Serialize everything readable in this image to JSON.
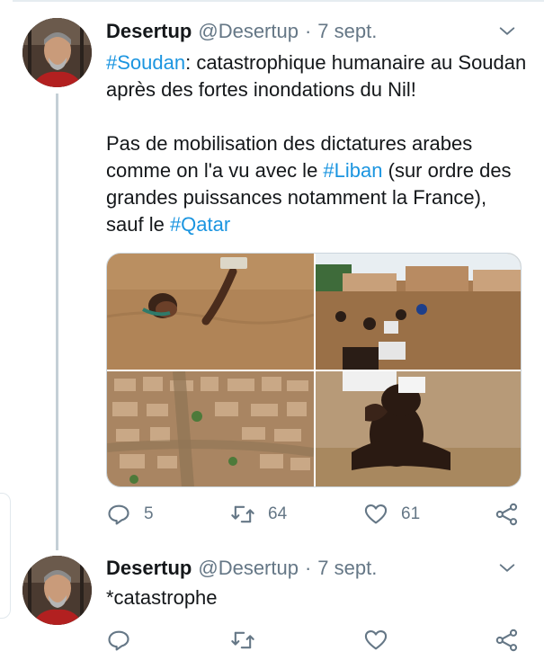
{
  "tweets": [
    {
      "author": {
        "name": "Desertup",
        "handle": "@Desertup"
      },
      "separator": "·",
      "date": "7 sept.",
      "paragraph1": {
        "hashtag1": "#Soudan",
        "text1": ": catastrophique humanaire au Soudan après des fortes inondations du Nil!"
      },
      "paragraph2": {
        "text1": "Pas de mobilisation des dictatures arabes comme on l'a vu avec le ",
        "hashtag1": "#Liban",
        "text2": " (sur ordre des grandes puissances notamment la France), sauf le ",
        "hashtag2": "#Qatar"
      },
      "actions": {
        "replies": "5",
        "retweets": "64",
        "likes": "61"
      },
      "media": [
        {
          "icon": "flood-swimmer-photo"
        },
        {
          "icon": "flooded-street-photo"
        },
        {
          "icon": "aerial-flooded-town-photo"
        },
        {
          "icon": "man-carrying-child-photo"
        }
      ]
    },
    {
      "author": {
        "name": "Desertup",
        "handle": "@Desertup"
      },
      "separator": "·",
      "date": "7 sept.",
      "text": "*catastrophe"
    }
  ],
  "colors": {
    "link": "#1b95e0",
    "muted": "#657786",
    "text": "#14171a",
    "flood": "#b98a5a"
  }
}
